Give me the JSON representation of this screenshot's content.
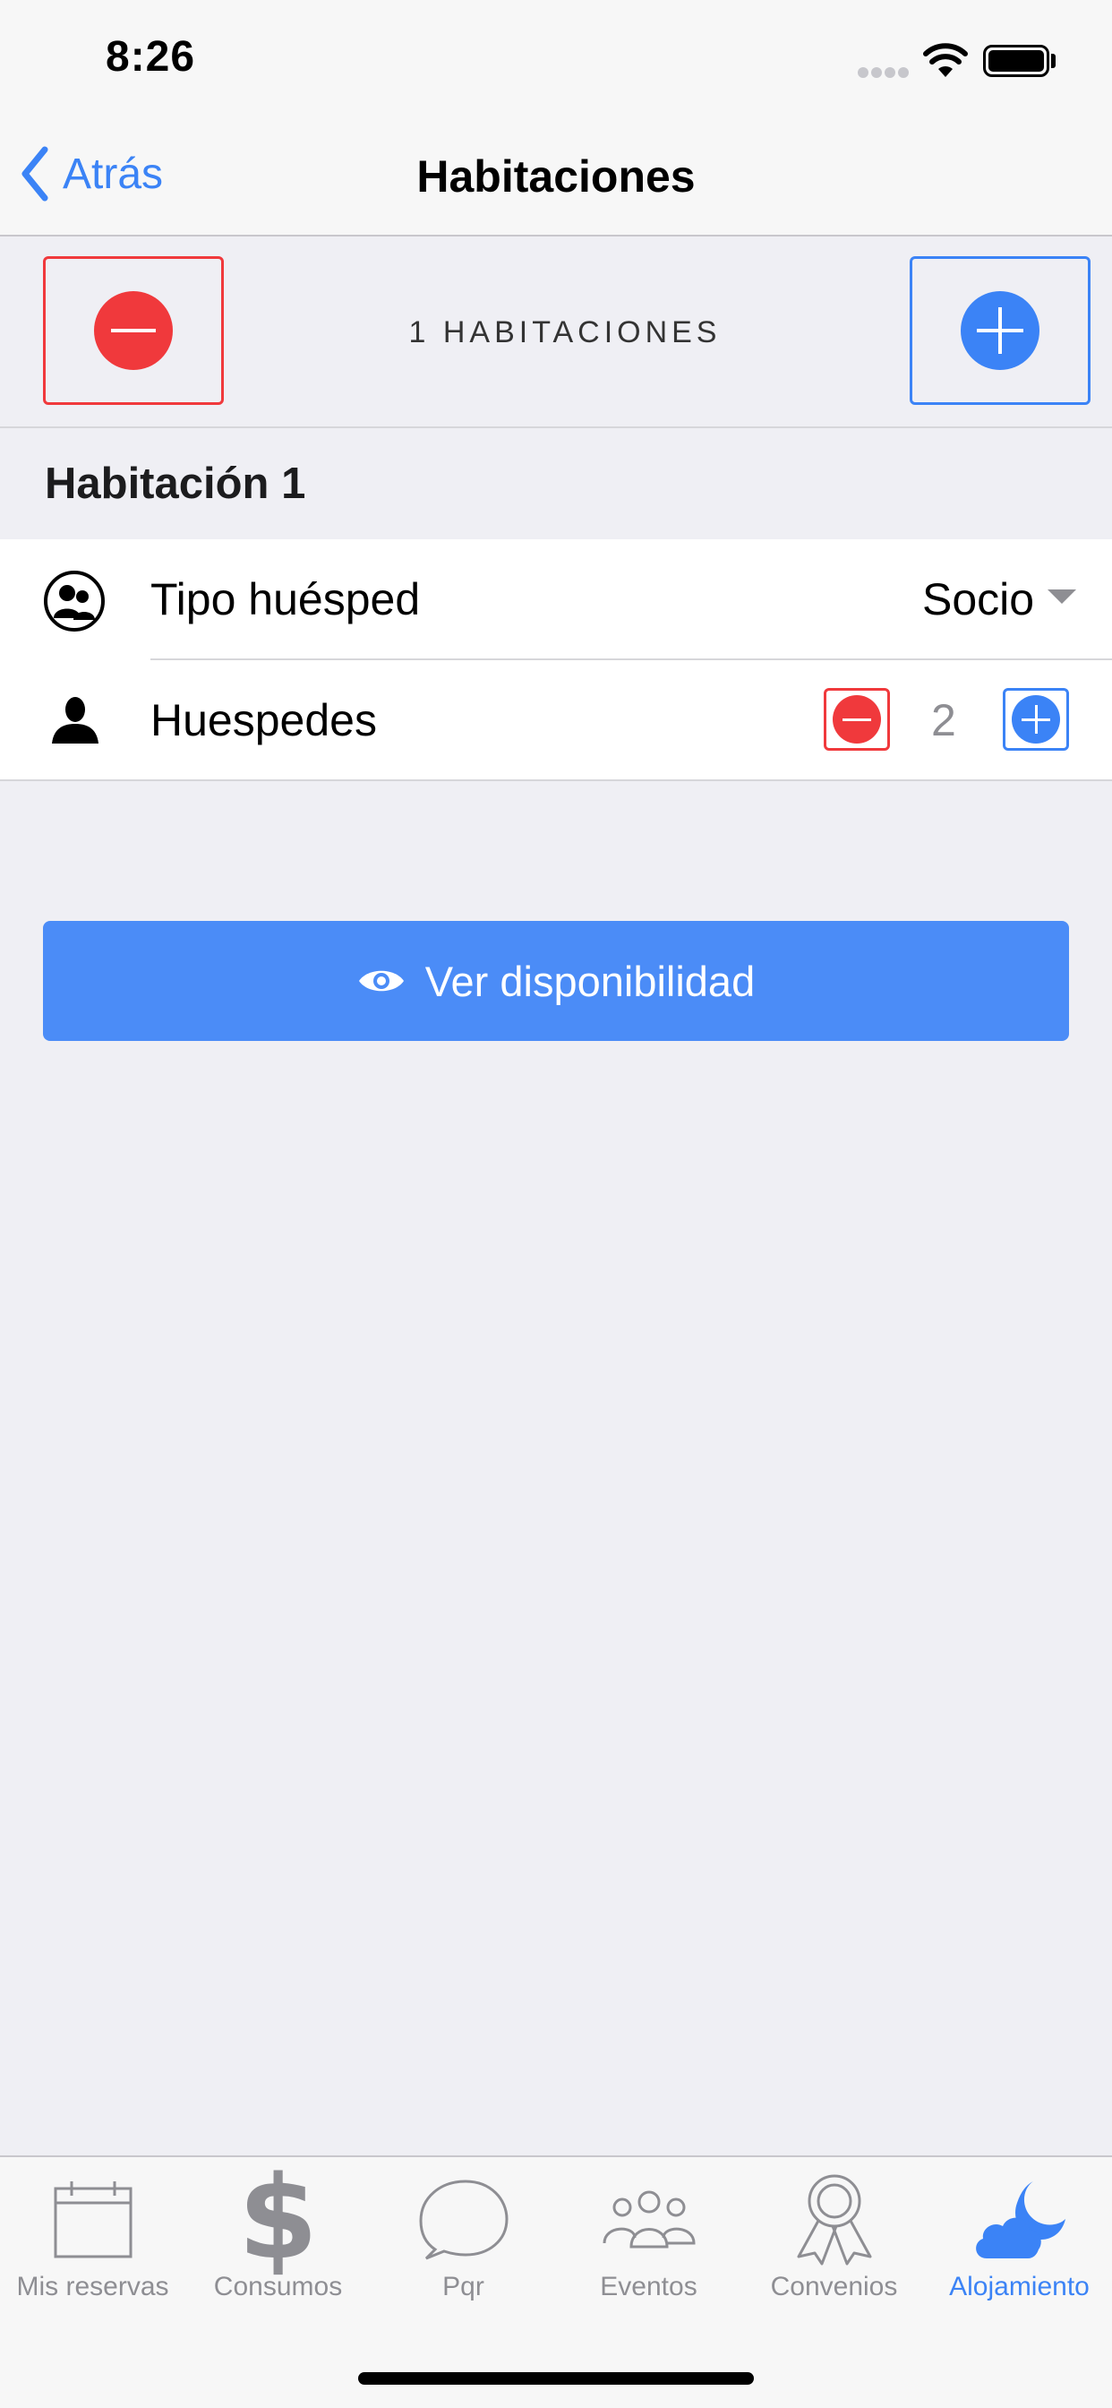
{
  "status_bar": {
    "time": "8:26"
  },
  "nav": {
    "back_label": "Atrás",
    "title": "Habitaciones"
  },
  "rooms": {
    "count_label": "1 HABITACIONES"
  },
  "room": {
    "title": "Habitación 1",
    "guest_type_label": "Tipo huésped",
    "guest_type_value": "Socio",
    "guests_label": "Huespedes",
    "guests_count": "2"
  },
  "action": {
    "label": "Ver disponibilidad"
  },
  "tabs": [
    {
      "label": "Mis reservas",
      "icon": "calendar-icon"
    },
    {
      "label": "Consumos",
      "icon": "dollar-icon"
    },
    {
      "label": "Pqr",
      "icon": "chat-bubble-icon"
    },
    {
      "label": "Eventos",
      "icon": "people-group-icon"
    },
    {
      "label": "Convenios",
      "icon": "ribbon-award-icon"
    },
    {
      "label": "Alojamiento",
      "icon": "moon-cloud-icon",
      "active": true
    }
  ],
  "colors": {
    "accent": "#3b83f6",
    "danger": "#f0393c",
    "button": "#4b8cf7",
    "background": "#efeff4"
  }
}
